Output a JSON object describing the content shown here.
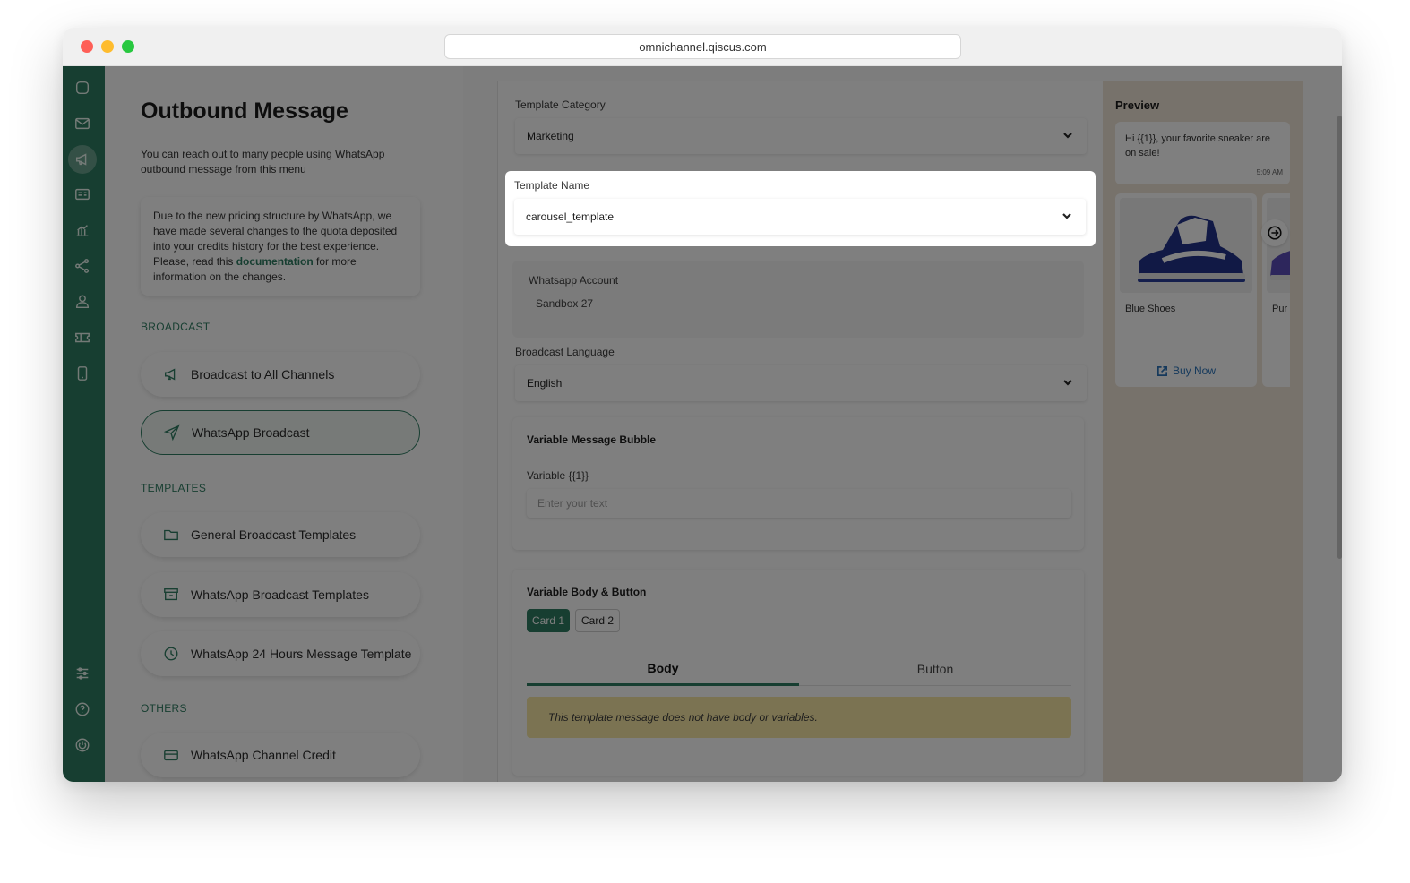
{
  "browser": {
    "url": "omnichannel.qiscus.com"
  },
  "sidebar": {
    "icons": [
      "chat-icon",
      "mail-icon",
      "megaphone-icon",
      "contact-card-icon",
      "analytics-icon",
      "share-nodes-icon",
      "agent-icon",
      "ticket-icon",
      "mobile-icon",
      "settings-sliders-icon",
      "help-icon",
      "power-icon"
    ],
    "active": "megaphone-icon"
  },
  "left": {
    "title": "Outbound Message",
    "description": "You can reach out to many people using WhatsApp outbound message from this menu",
    "notice": {
      "before": "Due to the new pricing structure by WhatsApp, we have made several changes to the quota deposited into your credits history for the best experience. Please, read this ",
      "link": "documentation",
      "after": " for more information on the changes."
    },
    "sections": {
      "broadcast": "BROADCAST",
      "templates": "TEMPLATES",
      "others": "OTHERS"
    },
    "nav": {
      "broadcast_all": "Broadcast to All Channels",
      "whatsapp_broadcast": "WhatsApp Broadcast",
      "general_templates": "General Broadcast Templates",
      "wa_templates": "WhatsApp Broadcast Templates",
      "wa_24h": "WhatsApp 24 Hours Message Template",
      "channel_credit": "WhatsApp Channel Credit"
    }
  },
  "form": {
    "template_category": {
      "label": "Template Category",
      "value": "Marketing"
    },
    "template_name": {
      "label": "Template Name",
      "value": "carousel_template"
    },
    "whatsapp_account": {
      "label": "Whatsapp Account",
      "value": "Sandbox 27"
    },
    "broadcast_language": {
      "label": "Broadcast Language",
      "value": "English"
    },
    "variable_bubble": {
      "title": "Variable Message Bubble",
      "variable_label": "Variable {{1}}",
      "placeholder": "Enter your text"
    },
    "variable_body": {
      "title": "Variable Body & Button",
      "cards": [
        "Card 1",
        "Card 2"
      ],
      "tabs": [
        "Body",
        "Button"
      ],
      "warning": "This template message does not have body or variables."
    }
  },
  "preview": {
    "title": "Preview",
    "bubble_text": "Hi {{1}}, your favorite sneaker are on sale!",
    "bubble_time": "5:09 AM",
    "cards": [
      {
        "name": "Blue Shoes",
        "button": "Buy Now"
      },
      {
        "name": "Pur",
        "button": ""
      }
    ]
  },
  "colors": {
    "brand": "#2f7d62",
    "preview_bg": "#efe4d7",
    "warning_bg": "#f7e7a5",
    "link": "#2a73b9"
  }
}
